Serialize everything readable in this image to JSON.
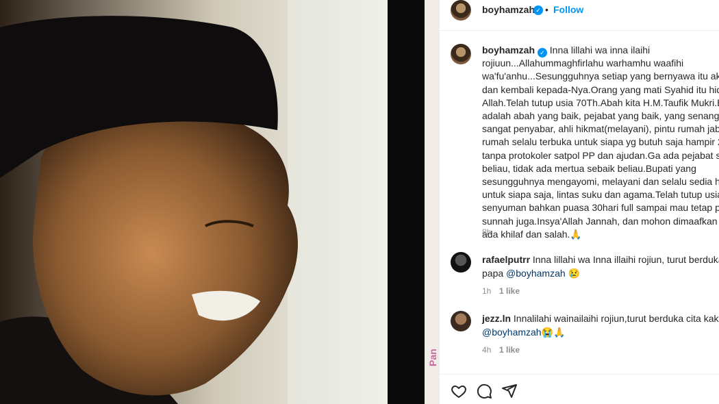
{
  "post": {
    "author": "boyhamzah",
    "follow_label": "Follow",
    "separator": "•",
    "caption_lines": [
      "Inna lillahi wa inna ilaihi",
      "rojiuun...Allahummaghfirlahu warhamhu waafihi",
      "wa'fu'anhu...Sesungguhnya setiap yang bernyawa itu akan",
      "dan kembali kepada-Nya.Orang yang mati Syahid itu hidup",
      "Allah.Telah tutup usia 70Th.Abah kita H.M.Taufik Mukri.Be",
      "adalah abah yang baik, pejabat yang baik, yang senang gu",
      "sangat penyabar, ahli hikmat(melayani), pintu rumah jabat",
      "rumah selalu terbuka untuk siapa yg butuh saja hampir 24",
      "tanpa protokoler satpol PP dan ajudan.Ga ada pejabat seb",
      "beliau, tidak ada mertua sebaik beliau.Bupati yang",
      "sesungguhnya mengayomi, melayani dan selalu sedia had",
      "untuk siapa saja, lintas suku dan agama.Telah tutup usia c",
      "senyuman bahkan puasa 30hari full sampai mau tetap pua",
      "sunnah juga.Insya'Allah Jannah, dan mohon dimaafkan se",
      "ada khilaf dan salah.🙏"
    ],
    "caption_time": "8h"
  },
  "comments": [
    {
      "user": "rafaelputrr",
      "text_line1": "Inna lillahi wa Inna illaihi rojiun, turut berduka y",
      "text_line2_prefix": "papa ",
      "mention": "@boyhamzah",
      "suffix": " 😢",
      "time": "1h",
      "likes": "1 like"
    },
    {
      "user": "jezz.ln",
      "text_line1": "Innalilahi wainailaihi rojiun,turut berduka cita kak",
      "text_line2_prefix": "",
      "mention": "@boyhamzah",
      "suffix": "😭🙏",
      "time": "4h",
      "likes": "1 like"
    }
  ],
  "side_strip_text": "Pan",
  "icons": [
    "heart-icon",
    "comment-icon",
    "share-icon",
    "verified-badge-icon"
  ],
  "colors": {
    "link": "#0095f6",
    "mention": "#00376b",
    "meta": "#8e8e8e",
    "text": "#262626"
  }
}
